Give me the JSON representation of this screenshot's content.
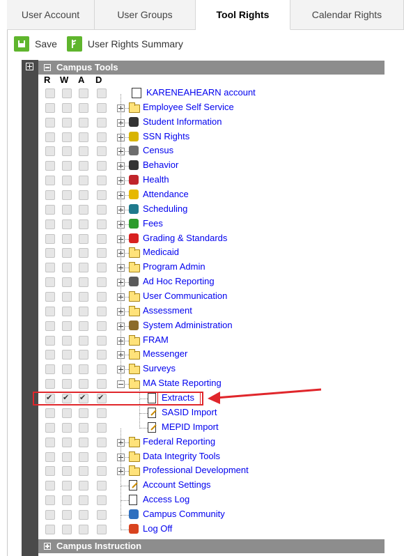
{
  "tabs": [
    {
      "label": "User Account"
    },
    {
      "label": "User Groups"
    },
    {
      "label": "Tool Rights"
    },
    {
      "label": "Calendar Rights"
    }
  ],
  "toolbar": {
    "save_label": "Save",
    "summary_label": "User Rights Summary"
  },
  "tree_header": {
    "label": "Campus Tools"
  },
  "columns": [
    "R",
    "W",
    "A",
    "D"
  ],
  "root": {
    "label": "KARENEAHEARN account"
  },
  "items": [
    {
      "label": "Employee Self Service",
      "icon": "folder-icon"
    },
    {
      "label": "Student Information",
      "icon": "student-icon"
    },
    {
      "label": "SSN Rights",
      "icon": "lock-icon"
    },
    {
      "label": "Census",
      "icon": "census-icon"
    },
    {
      "label": "Behavior",
      "icon": "behavior-icon"
    },
    {
      "label": "Health",
      "icon": "health-icon"
    },
    {
      "label": "Attendance",
      "icon": "attendance-icon"
    },
    {
      "label": "Scheduling",
      "icon": "scheduling-icon"
    },
    {
      "label": "Fees",
      "icon": "dollar-icon"
    },
    {
      "label": "Grading & Standards",
      "icon": "grade-icon"
    },
    {
      "label": "Medicaid",
      "icon": "folder-icon"
    },
    {
      "label": "Program Admin",
      "icon": "folder-icon"
    },
    {
      "label": "Ad Hoc Reporting",
      "icon": "report-icon"
    },
    {
      "label": "User Communication",
      "icon": "folder-icon"
    },
    {
      "label": "Assessment",
      "icon": "folder-icon"
    },
    {
      "label": "System Administration",
      "icon": "sysadmin-icon"
    },
    {
      "label": "FRAM",
      "icon": "folder-icon"
    },
    {
      "label": "Messenger",
      "icon": "folder-icon"
    },
    {
      "label": "Surveys",
      "icon": "folder-icon"
    },
    {
      "label": "MA State Reporting",
      "icon": "folder-icon"
    },
    {
      "label": "Extracts",
      "icon": "document-icon"
    },
    {
      "label": "SASID Import",
      "icon": "edit-doc-icon"
    },
    {
      "label": "MEPID Import",
      "icon": "edit-doc-icon"
    },
    {
      "label": "Federal Reporting",
      "icon": "folder-icon"
    },
    {
      "label": "Data Integrity Tools",
      "icon": "folder-icon"
    },
    {
      "label": "Professional Development",
      "icon": "folder-icon"
    },
    {
      "label": "Account Settings",
      "icon": "edit-doc-icon"
    },
    {
      "label": "Access Log",
      "icon": "document-icon"
    },
    {
      "label": "Campus Community",
      "icon": "community-icon"
    },
    {
      "label": "Log Off",
      "icon": "logoff-icon"
    }
  ],
  "bottom_header": {
    "label": "Campus Instruction"
  },
  "colors": {
    "accent_green": "#5fb52d",
    "header_grey": "#8d8d8d",
    "link_blue": "#0000ee",
    "highlight_red": "#e0262b"
  }
}
